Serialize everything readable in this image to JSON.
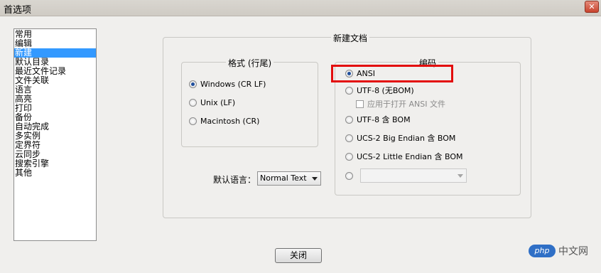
{
  "window": {
    "title": "首选项",
    "close_symbol": "✕"
  },
  "categories": [
    {
      "label": "常用",
      "selected": false
    },
    {
      "label": "编辑",
      "selected": false
    },
    {
      "label": "新建",
      "selected": true
    },
    {
      "label": "默认目录",
      "selected": false
    },
    {
      "label": "最近文件记录",
      "selected": false
    },
    {
      "label": "文件关联",
      "selected": false
    },
    {
      "label": "语言",
      "selected": false
    },
    {
      "label": "高亮",
      "selected": false
    },
    {
      "label": "打印",
      "selected": false
    },
    {
      "label": "备份",
      "selected": false
    },
    {
      "label": "自动完成",
      "selected": false
    },
    {
      "label": "多实例",
      "selected": false
    },
    {
      "label": "定界符",
      "selected": false
    },
    {
      "label": "云同步",
      "selected": false
    },
    {
      "label": "搜索引擎",
      "selected": false
    },
    {
      "label": "其他",
      "selected": false
    }
  ],
  "new_doc": {
    "title": "新建文档",
    "format": {
      "title": "格式 (行尾)",
      "options": [
        "Windows (CR LF)",
        "Unix (LF)",
        "Macintosh (CR)"
      ],
      "selected_index": 0
    },
    "encoding": {
      "title": "编码",
      "options": [
        "ANSI",
        "UTF-8 (无BOM)",
        "UTF-8 含 BOM",
        "UCS-2 Big Endian 含 BOM",
        "UCS-2 Little Endian 含 BOM"
      ],
      "selected_index": 0,
      "apply_ansi_label": "应用于打开 ANSI 文件",
      "apply_ansi_checked": false,
      "other_encoding_value": ""
    },
    "default_lang": {
      "label": "默认语言：",
      "value": "Normal Text"
    }
  },
  "close_button": "关闭",
  "watermark": {
    "logo": "php",
    "text": "中文网"
  },
  "colors": {
    "selection": "#3399ff",
    "highlight_box": "#e30d0d"
  }
}
